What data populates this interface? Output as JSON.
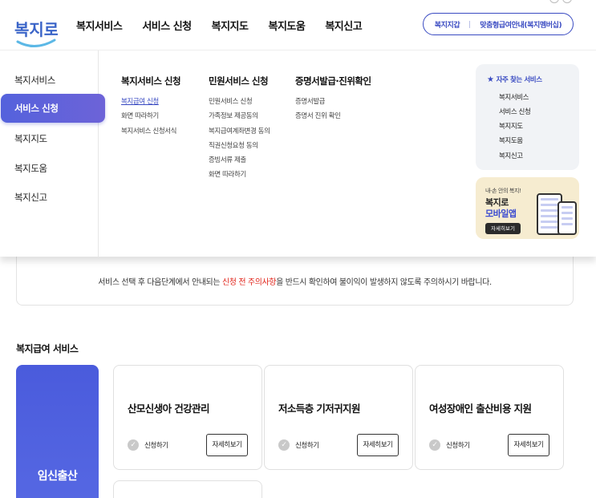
{
  "header": {
    "logo_text": "복지로",
    "nav": [
      "복지서비스",
      "서비스 신청",
      "복지지도",
      "복지도움",
      "복지신고"
    ],
    "pill": {
      "left": "복지지갑",
      "right": "맞춤형급여안내(복지멤버십)"
    }
  },
  "mega_menu": {
    "left_nav": [
      "복지서비스",
      "서비스 신청",
      "복지지도",
      "복지도움",
      "복지신고"
    ],
    "active_index": 1,
    "columns": [
      {
        "heading": "복지서비스 신청",
        "links": [
          "복지급여 신청",
          "화면 따라하기",
          "복지서비스 신청서식"
        ]
      },
      {
        "heading": "민원서비스 신청",
        "links": [
          "민원서비스 신청",
          "가족정보 제공동의",
          "복지급여계좌변경 동의",
          "직권신청요청 동의",
          "증빙서류 제출",
          "화면 따라하기"
        ]
      },
      {
        "heading": "증명서발급·진위확인",
        "links": [
          "증명서발급",
          "증명서 진위 확인"
        ]
      }
    ],
    "selected_link": "복지급여 신청",
    "favorites": {
      "title": "자주 찾는 서비스",
      "items": [
        "복지서비스",
        "서비스 신청",
        "복지지도",
        "복지도움",
        "복지신고"
      ]
    },
    "banner": {
      "line1": "내-손 안의 복지!",
      "line2": "복지로",
      "line3": "모바일앱",
      "button": "자세히보기"
    }
  },
  "notice": {
    "before": "서비스 선택 후 다음단계에서 안내되는 ",
    "highlight": "신청 전 주의사항",
    "after": "을 반드시 확인하여 불이익이 발생하지 않도록 주의하시기 바랍니다."
  },
  "section": {
    "title": "복지급여 서비스",
    "category": "임신출산",
    "cards": [
      {
        "title": "산모신생아 건강관리",
        "apply": "신청하기",
        "more": "자세히보기"
      },
      {
        "title": "저소득층 기저귀지원",
        "apply": "신청하기",
        "more": "자세히보기"
      },
      {
        "title": "여성장애인 출산비용 지원",
        "apply": "신청하기",
        "more": "자세히보기"
      }
    ]
  },
  "colors": {
    "brand": "#3a4bc2",
    "active_nav": "#5462dc",
    "warning": "#e1251b",
    "banner_bg": "#f6ecd0"
  },
  "icons": {
    "favorites": "star-icon",
    "apply": "check-circle-icon"
  }
}
